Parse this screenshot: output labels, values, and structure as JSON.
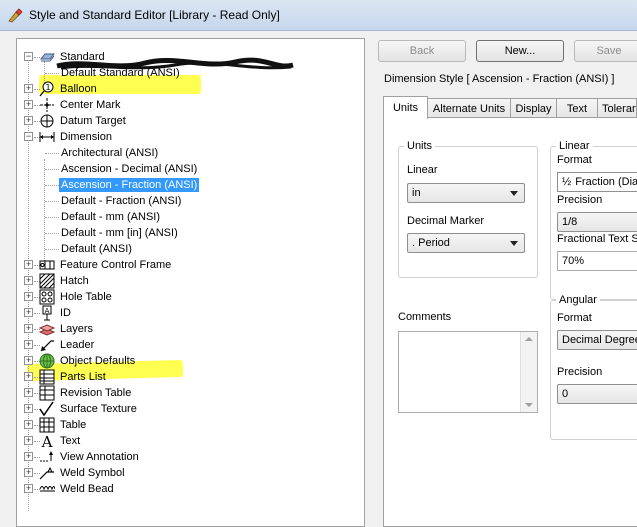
{
  "window": {
    "title": "Style and Standard Editor [Library - Read Only]"
  },
  "tree": {
    "items": [
      {
        "label": "Standard",
        "icon": "standard-icon"
      },
      {
        "label": "Default Standard (ANSI)",
        "icon": ""
      },
      {
        "label": "Balloon",
        "icon": "balloon-icon"
      },
      {
        "label": "Center Mark",
        "icon": "center-mark-icon"
      },
      {
        "label": "Datum Target",
        "icon": "datum-target-icon"
      },
      {
        "label": "Dimension",
        "icon": "dimension-icon"
      },
      {
        "label": "Architectural (ANSI)",
        "icon": ""
      },
      {
        "label": "Ascension - Decimal (ANSI)",
        "icon": ""
      },
      {
        "label": "Ascension - Fraction (ANSI)",
        "icon": ""
      },
      {
        "label": "Default - Fraction (ANSI)",
        "icon": ""
      },
      {
        "label": "Default - mm (ANSI)",
        "icon": ""
      },
      {
        "label": "Default - mm [in] (ANSI)",
        "icon": ""
      },
      {
        "label": "Default (ANSI)",
        "icon": ""
      },
      {
        "label": "Feature Control Frame",
        "icon": "feature-control-frame-icon"
      },
      {
        "label": "Hatch",
        "icon": "hatch-icon"
      },
      {
        "label": "Hole Table",
        "icon": "hole-table-icon"
      },
      {
        "label": "ID",
        "icon": "id-icon"
      },
      {
        "label": "Layers",
        "icon": "layers-icon"
      },
      {
        "label": "Leader",
        "icon": "leader-icon"
      },
      {
        "label": "Object Defaults",
        "icon": "object-defaults-icon"
      },
      {
        "label": "Parts List",
        "icon": "parts-list-icon"
      },
      {
        "label": "Revision Table",
        "icon": "revision-table-icon"
      },
      {
        "label": "Surface Texture",
        "icon": "surface-texture-icon"
      },
      {
        "label": "Table",
        "icon": "table-icon"
      },
      {
        "label": "Text",
        "icon": "text-icon"
      },
      {
        "label": "View Annotation",
        "icon": "view-annotation-icon"
      },
      {
        "label": "Weld Symbol",
        "icon": "weld-symbol-icon"
      },
      {
        "label": "Weld Bead",
        "icon": "weld-bead-icon"
      }
    ],
    "selected": "Ascension - Fraction (ANSI)",
    "highlight_color": "#ffff33",
    "selection_color": "#3399ff"
  },
  "toolbar": {
    "back_label": "Back",
    "new_label": "New...",
    "save_label": "Save"
  },
  "style_heading": "Dimension Style [ Ascension - Fraction (ANSI) ]",
  "tabs": [
    "Units",
    "Alternate Units",
    "Display",
    "Text",
    "Toleran"
  ],
  "units_group": {
    "title": "Units",
    "linear_label": "Linear",
    "linear_value": "in",
    "decimal_marker_label": "Decimal Marker",
    "decimal_marker_value": ". Period"
  },
  "linear_group": {
    "title": "Linear",
    "format_label": "Format",
    "format_value": "Fraction (Dia",
    "format_glyph": "½",
    "precision_label": "Precision",
    "precision_value": "1/8",
    "fractional_label": "Fractional Text S",
    "fractional_value": "70%"
  },
  "comments": {
    "label": "Comments"
  },
  "angular_group": {
    "title": "Angular",
    "format_label": "Format",
    "format_value": "Decimal Degrees",
    "precision_label": "Precision",
    "precision_value": "0"
  }
}
